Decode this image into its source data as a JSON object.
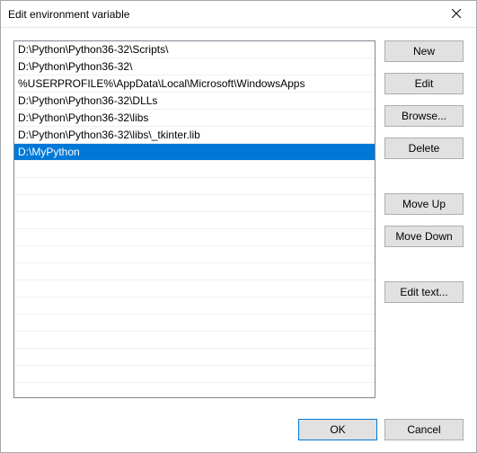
{
  "window": {
    "title": "Edit environment variable"
  },
  "paths": [
    "D:\\Python\\Python36-32\\Scripts\\",
    "D:\\Python\\Python36-32\\",
    "%USERPROFILE%\\AppData\\Local\\Microsoft\\WindowsApps",
    "D:\\Python\\Python36-32\\DLLs",
    "D:\\Python\\Python36-32\\libs",
    "D:\\Python\\Python36-32\\libs\\_tkinter.lib",
    "D:\\MyPython"
  ],
  "selected_index": 6,
  "buttons": {
    "new": "New",
    "edit": "Edit",
    "browse": "Browse...",
    "delete": "Delete",
    "move_up": "Move Up",
    "move_down": "Move Down",
    "edit_text": "Edit text...",
    "ok": "OK",
    "cancel": "Cancel"
  }
}
